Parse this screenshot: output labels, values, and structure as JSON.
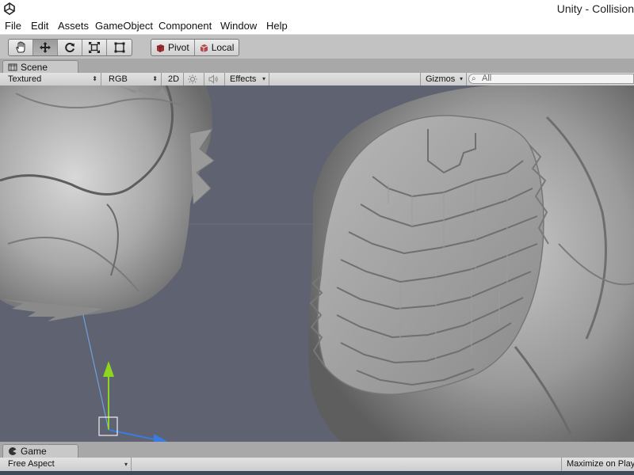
{
  "window": {
    "title": "Unity - Collision"
  },
  "menu": [
    "File",
    "Edit",
    "Assets",
    "GameObject",
    "Component",
    "Window",
    "Help"
  ],
  "toolbar": {
    "tools": [
      "hand-icon",
      "move-icon",
      "rotate-icon",
      "scale-icon",
      "rect-icon"
    ],
    "active_tool": "move-icon",
    "pivot_label": "Pivot",
    "local_label": "Local"
  },
  "scene": {
    "tab_label": "Scene",
    "shading_mode": "Textured",
    "render_mode": "RGB",
    "mode_2d": "2D",
    "effects_label": "Effects",
    "gizmos_label": "Gizmos",
    "search_placeholder": "All"
  },
  "game": {
    "tab_label": "Game",
    "aspect": "Free Aspect",
    "maximize_label": "Maximize on Play"
  },
  "colors": {
    "viewport_bg": "#5f6270",
    "gizmo_y": "#8ed61f",
    "gizmo_x": "#3b7be0"
  }
}
